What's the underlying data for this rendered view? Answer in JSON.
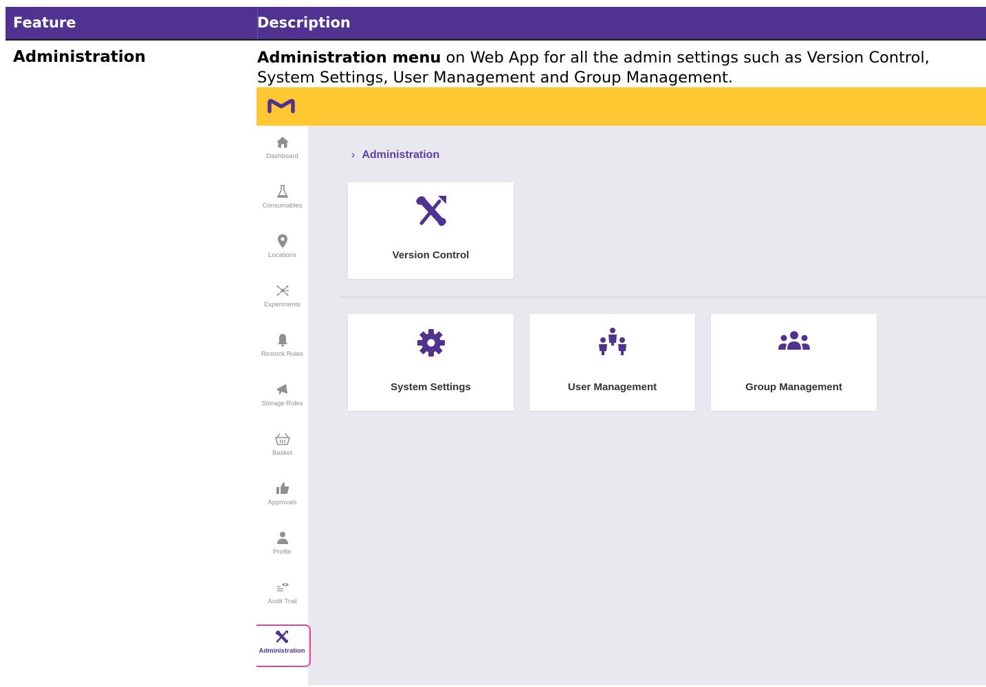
{
  "table": {
    "header_feature": "Feature",
    "header_description": "Description",
    "feature": "Administration",
    "description_bold": "Administration menu",
    "description_rest": " on Web App for all the admin settings such as Version Control, System Settings, User Management and Group Management."
  },
  "app": {
    "logo_icon": "merck-m-logo",
    "brand_yellow": "#ffc832",
    "accent_purple": "#503291",
    "highlight_pink": "#e0439a",
    "breadcrumb": "Administration",
    "sidebar": [
      {
        "label": "Dashboard",
        "icon": "home-icon"
      },
      {
        "label": "Consumables",
        "icon": "flask-icon"
      },
      {
        "label": "Locations",
        "icon": "map-pin-icon"
      },
      {
        "label": "Experiments",
        "icon": "network-icon"
      },
      {
        "label": "Restock Rules",
        "icon": "bell-icon"
      },
      {
        "label": "Storage Rules",
        "icon": "megaphone-icon"
      },
      {
        "label": "Basket",
        "icon": "basket-icon"
      },
      {
        "label": "Approvals",
        "icon": "thumbs-up-icon"
      },
      {
        "label": "Profile",
        "icon": "user-icon"
      },
      {
        "label": "Audit Trail",
        "icon": "eye-list-icon"
      },
      {
        "label": "Administration",
        "icon": "tools-icon"
      }
    ],
    "cards": [
      {
        "label": "Version Control",
        "icon": "tools-icon"
      },
      {
        "label": "System Settings",
        "icon": "gear-icon"
      },
      {
        "label": "User Management",
        "icon": "user-hierarchy-icon"
      },
      {
        "label": "Group Management",
        "icon": "users-group-icon"
      }
    ]
  }
}
